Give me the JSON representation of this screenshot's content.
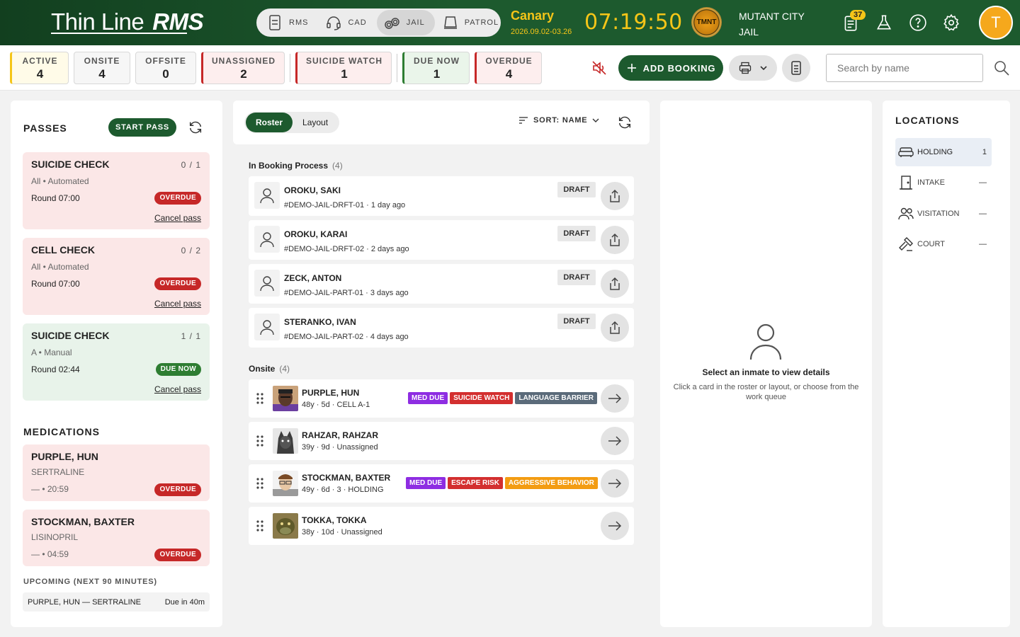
{
  "header": {
    "logo_thin": "Thin Line",
    "logo_rms": "RMS",
    "modules": [
      {
        "label": "RMS",
        "icon": "records-icon"
      },
      {
        "label": "CAD",
        "icon": "headset-icon"
      },
      {
        "label": "JAIL",
        "icon": "handcuffs-icon",
        "active": true
      },
      {
        "label": "PATROL",
        "icon": "patrol-car-icon"
      }
    ],
    "environment": "Canary",
    "env_dates": "2026.09.02-03.26",
    "clock": "07:19:50",
    "seal_text": "TMNT",
    "agency_city": "MUTANT CITY",
    "agency_unit": "JAIL",
    "notifications_count": "37",
    "avatar_initial": "T"
  },
  "status": {
    "stats": [
      {
        "label": "ACTIVE",
        "value": "4"
      },
      {
        "label": "ONSITE",
        "value": "4"
      },
      {
        "label": "OFFSITE",
        "value": "0"
      },
      {
        "label": "UNASSIGNED",
        "value": "2"
      },
      {
        "label": "SUICIDE WATCH",
        "value": "1"
      },
      {
        "label": "DUE NOW",
        "value": "1"
      },
      {
        "label": "OVERDUE",
        "value": "4"
      }
    ],
    "add_booking": "ADD BOOKING",
    "search_placeholder": "Search by name"
  },
  "passes": {
    "title": "PASSES",
    "start_pass": "START PASS",
    "cards": [
      {
        "title": "SUICIDE CHECK",
        "count": "0 / 1",
        "sub": "All • Automated",
        "round": "Round 07:00",
        "status": "OVERDUE",
        "cancel": "Cancel pass"
      },
      {
        "title": "CELL CHECK",
        "count": "0 / 2",
        "sub": "All • Automated",
        "round": "Round 07:00",
        "status": "OVERDUE",
        "cancel": "Cancel pass"
      },
      {
        "title": "SUICIDE CHECK",
        "count": "1 / 1",
        "sub": "A • Manual",
        "round": "Round 02:44",
        "status": "DUE NOW",
        "cancel": "Cancel pass"
      }
    ]
  },
  "medications": {
    "title": "MEDICATIONS",
    "cards": [
      {
        "name": "PURPLE, HUN",
        "drug": "SERTRALINE",
        "time": "— • 20:59",
        "status": "OVERDUE"
      },
      {
        "name": "STOCKMAN, BAXTER",
        "drug": "LISINOPRIL",
        "time": "— • 04:59",
        "status": "OVERDUE"
      }
    ],
    "upcoming_title": "UPCOMING (NEXT 90 MINUTES)",
    "upcoming": {
      "text": "PURPLE, HUN — SERTRALINE",
      "due": "Due in 40m"
    }
  },
  "roster": {
    "tabs": [
      "Roster",
      "Layout"
    ],
    "sort_label": "SORT: NAME",
    "booking_group": "In Booking Process",
    "booking_count": "(4)",
    "booking": [
      {
        "name": "OROKU, SAKI",
        "id": "#DEMO-JAIL-DRFT-01",
        "ago": "· 1 day ago",
        "status": "DRAFT"
      },
      {
        "name": "OROKU, KARAI",
        "id": "#DEMO-JAIL-DRFT-02",
        "ago": "· 2 days ago",
        "status": "DRAFT"
      },
      {
        "name": "ZECK, ANTON",
        "id": "#DEMO-JAIL-PART-01",
        "ago": "· 3 days ago",
        "status": "DRAFT"
      },
      {
        "name": "STERANKO, IVAN",
        "id": "#DEMO-JAIL-PART-02",
        "ago": "· 4 days ago",
        "status": "DRAFT"
      }
    ],
    "onsite_group": "Onsite",
    "onsite_count": "(4)",
    "onsite": [
      {
        "name": "PURPLE, HUN",
        "meta": "48y · 5d · CELL A-1",
        "tags": [
          {
            "text": "MED DUE",
            "color": "#8e2de2"
          },
          {
            "text": "SUICIDE WATCH",
            "color": "#d32f2f"
          },
          {
            "text": "LANGUAGE BARRIER",
            "color": "#5b6b7a"
          }
        ]
      },
      {
        "name": "RAHZAR, RAHZAR",
        "meta": "39y · 9d · Unassigned",
        "tags": []
      },
      {
        "name": "STOCKMAN, BAXTER",
        "meta": "49y · 6d · 3 · HOLDING",
        "tags": [
          {
            "text": "MED DUE",
            "color": "#8e2de2"
          },
          {
            "text": "ESCAPE RISK",
            "color": "#d32f2f"
          },
          {
            "text": "AGGRESSIVE BEHAVIOR",
            "color": "#f39c12"
          }
        ]
      },
      {
        "name": "TOKKA, TOKKA",
        "meta": "38y · 10d · Unassigned",
        "tags": []
      }
    ]
  },
  "detail": {
    "title": "Select an inmate to view details",
    "subtitle": "Click a card in the roster or layout, or choose from the work queue"
  },
  "locations": {
    "title": "LOCATIONS",
    "items": [
      {
        "label": "HOLDING",
        "count": "1",
        "icon": "couch-icon"
      },
      {
        "label": "INTAKE",
        "count": "—",
        "icon": "door-icon"
      },
      {
        "label": "VISITATION",
        "count": "—",
        "icon": "people-icon"
      },
      {
        "label": "COURT",
        "count": "—",
        "icon": "gavel-icon"
      }
    ]
  },
  "colors": {
    "brand_green": "#1d5a2e",
    "accent_yellow": "#f5c518",
    "overdue_red": "#c62828",
    "due_green": "#2e7d32"
  }
}
